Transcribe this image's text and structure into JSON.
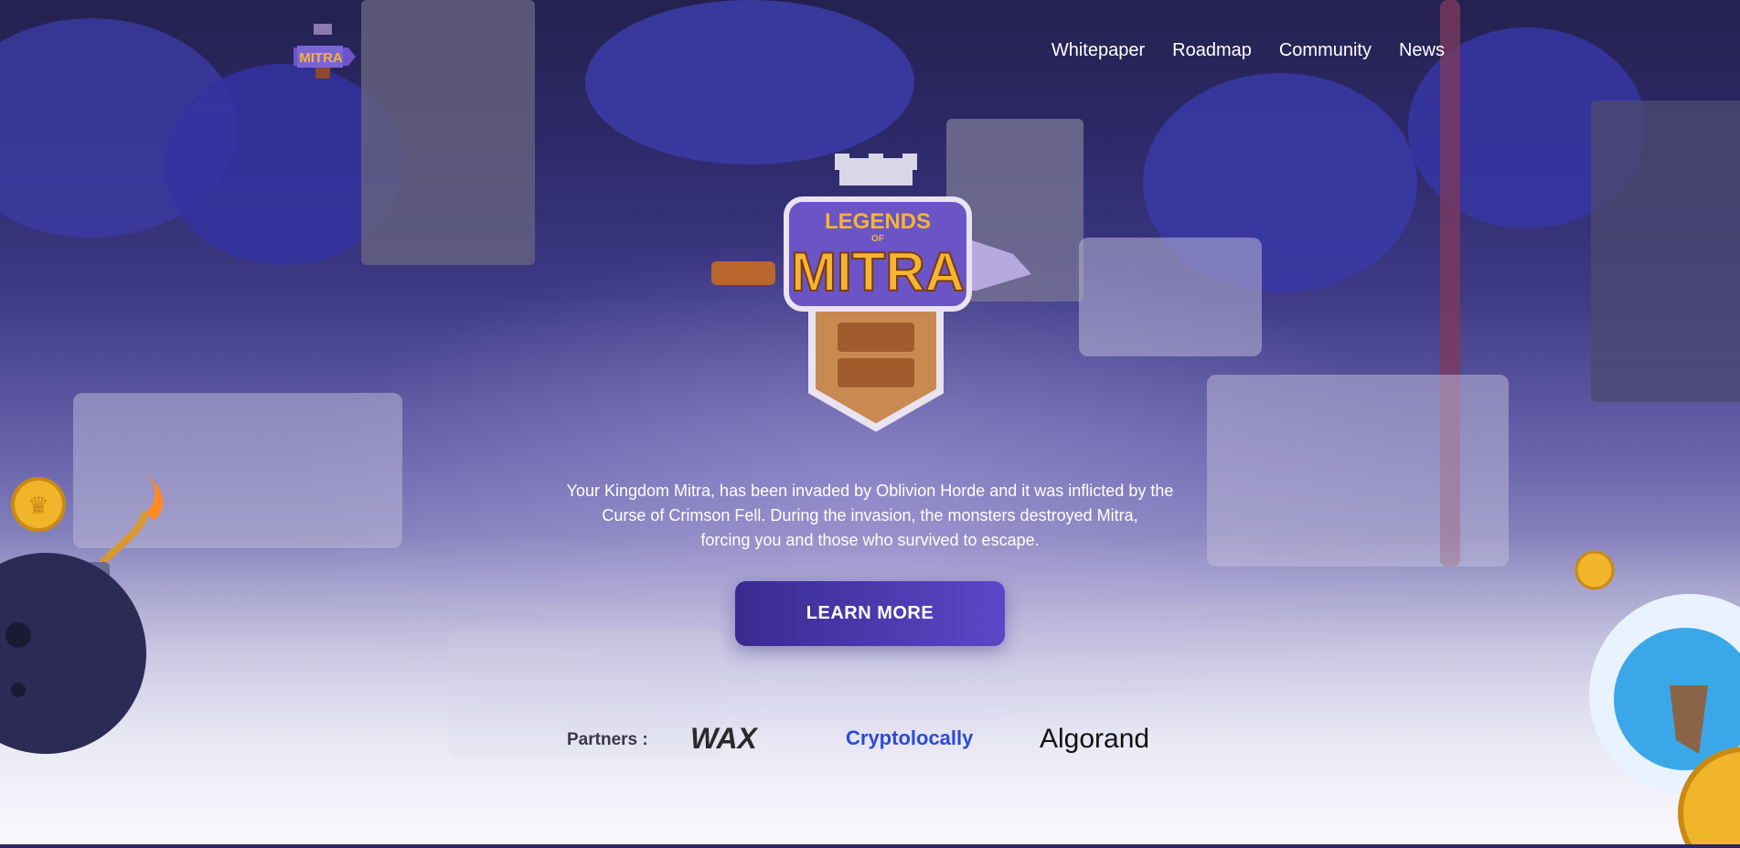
{
  "header": {
    "logo_text": "MITRA",
    "nav": [
      {
        "label": "Whitepaper"
      },
      {
        "label": "Roadmap"
      },
      {
        "label": "Community"
      },
      {
        "label": "News"
      }
    ]
  },
  "hero": {
    "logo_line1": "LEGENDS",
    "logo_line2": "OF",
    "logo_line3": "MITRA",
    "tagline_lines": [
      "Your Kingdom Mitra, has been invaded by Oblivion Horde and it was inflicted by the",
      "Curse of Crimson Fell. During the invasion, the monsters destroyed Mitra,",
      "forcing you and those who survived to escape."
    ],
    "cta_label": "LEARN MORE"
  },
  "partners": {
    "label": "Partners :",
    "items": [
      {
        "name": "WAX",
        "icon": "wax-logo"
      },
      {
        "name": "Cryptolocally",
        "icon": "cryptolocally-logo"
      },
      {
        "name": "Algorand",
        "icon": "algorand-logo"
      }
    ]
  },
  "colors": {
    "cta_start": "#3a2a8f",
    "cta_end": "#5a48c7",
    "logo_gold": "#f5b435",
    "logo_purple": "#6a54c6",
    "cryptolocally_blue": "#2a4bd8"
  }
}
